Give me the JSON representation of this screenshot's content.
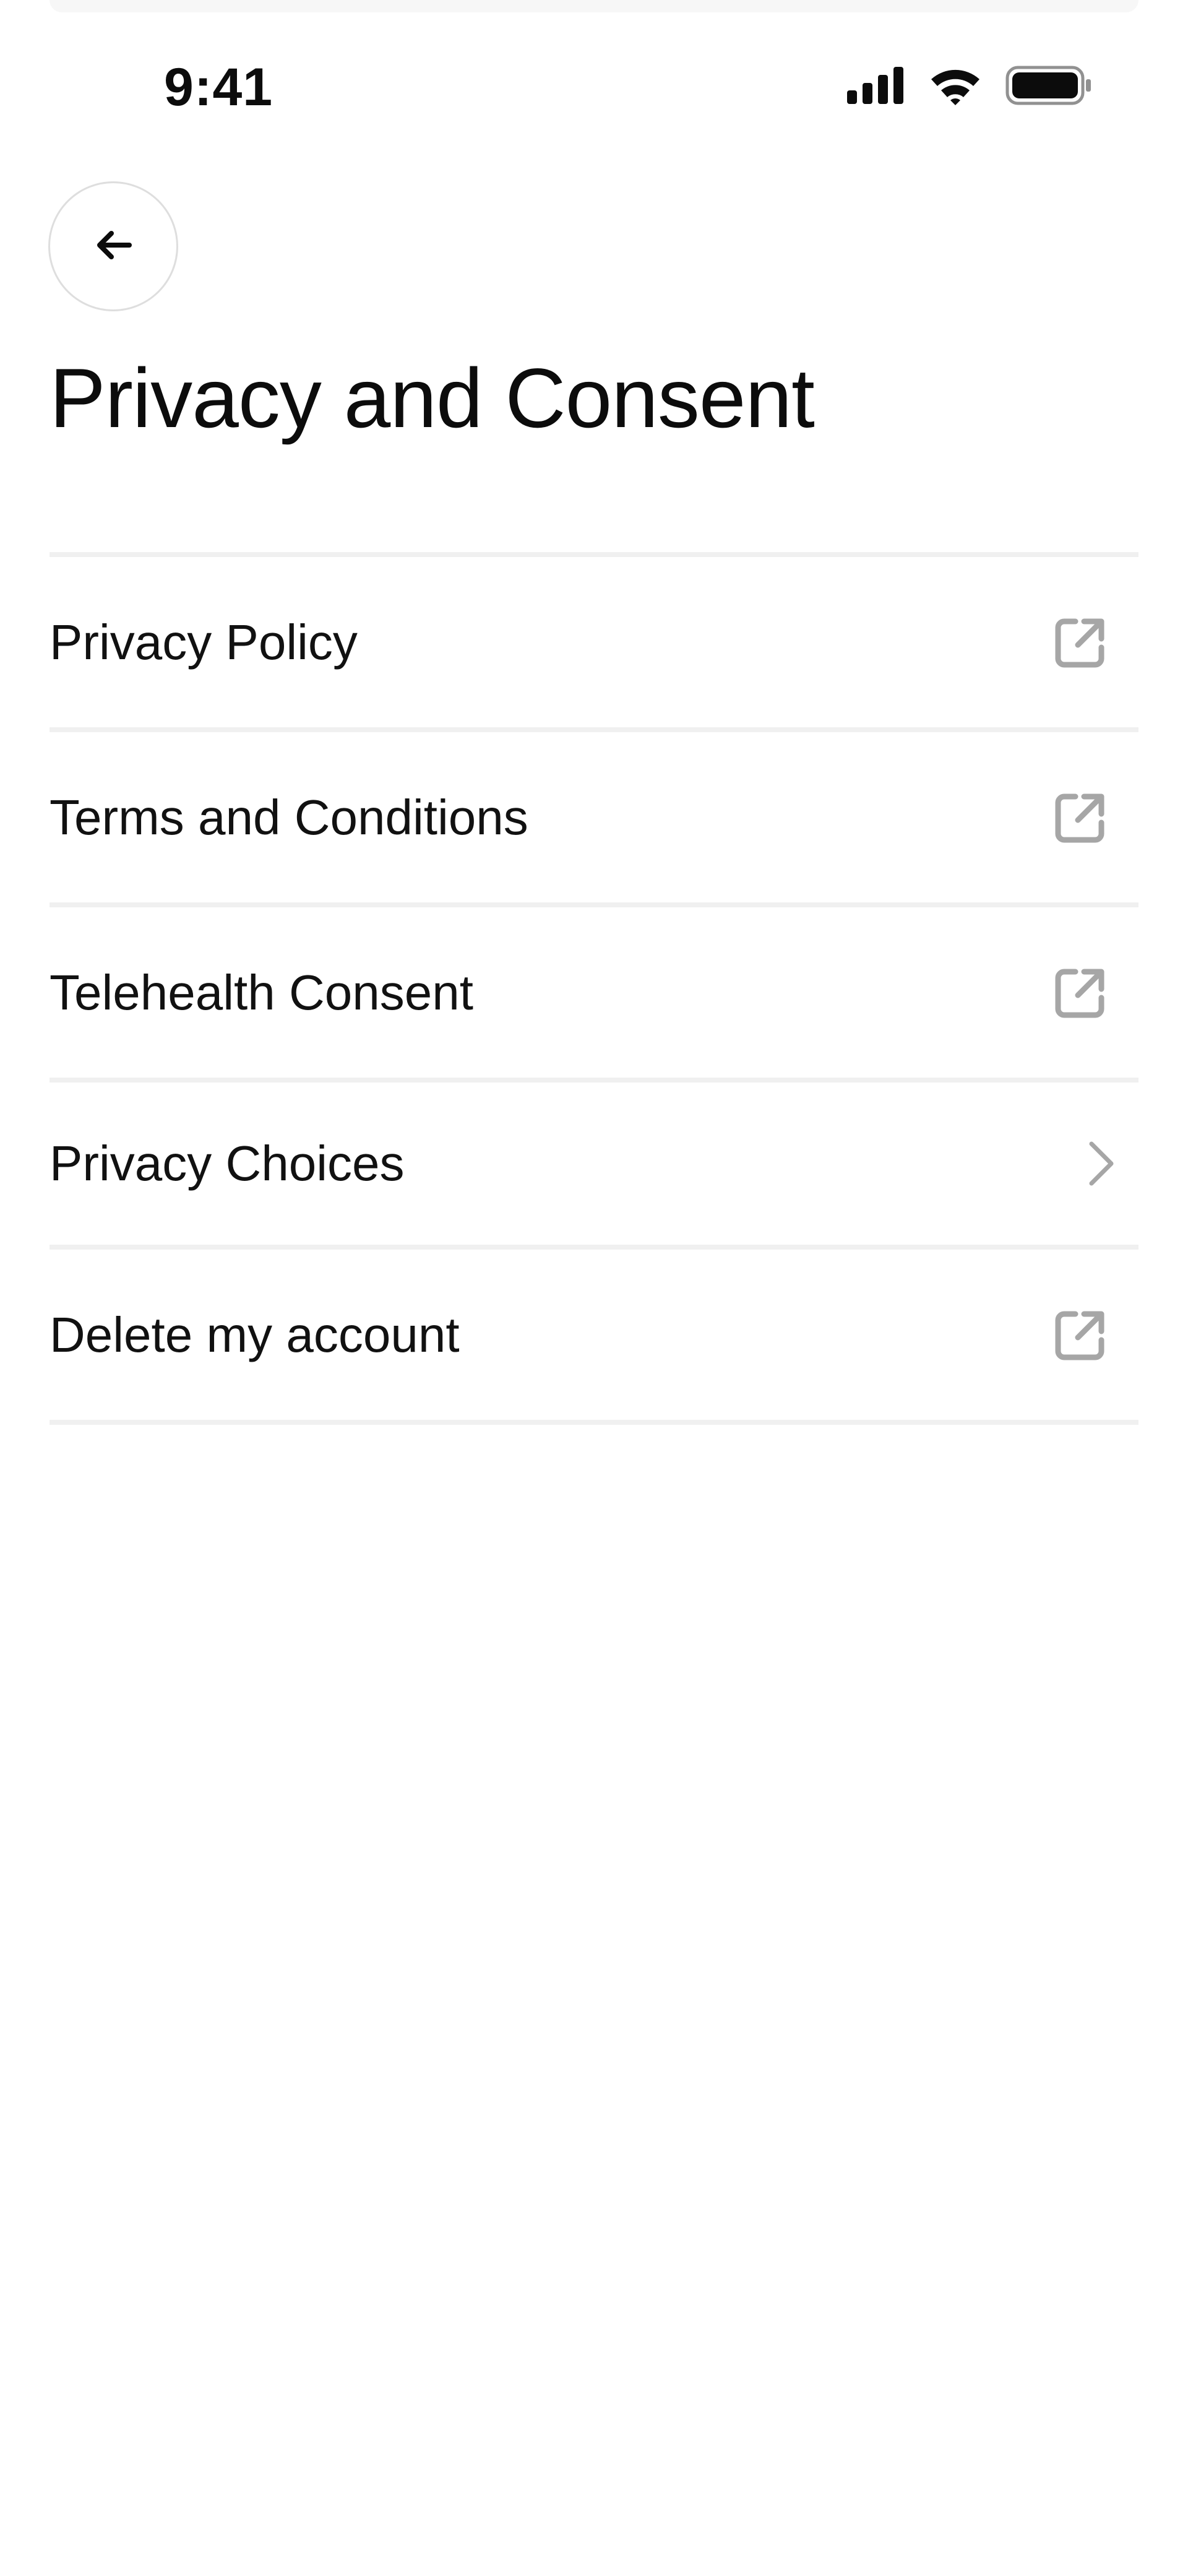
{
  "status_bar": {
    "time": "9:41",
    "icons": [
      "cellular-signal-icon",
      "wifi-icon",
      "battery-icon"
    ]
  },
  "header": {
    "back_icon": "arrow-left-icon",
    "title": "Privacy and Consent"
  },
  "menu": {
    "items": [
      {
        "label": "Privacy Policy",
        "icon": "external-link-icon"
      },
      {
        "label": "Terms and Conditions",
        "icon": "external-link-icon"
      },
      {
        "label": "Telehealth Consent",
        "icon": "external-link-icon"
      },
      {
        "label": "Privacy Choices",
        "icon": "chevron-right-icon"
      },
      {
        "label": "Delete my account",
        "icon": "external-link-icon"
      }
    ]
  },
  "colors": {
    "background": "#ffffff",
    "text": "#111111",
    "divider": "#f0f0f0",
    "icon_muted": "#a6a6a6",
    "back_button_border": "#dedede"
  }
}
